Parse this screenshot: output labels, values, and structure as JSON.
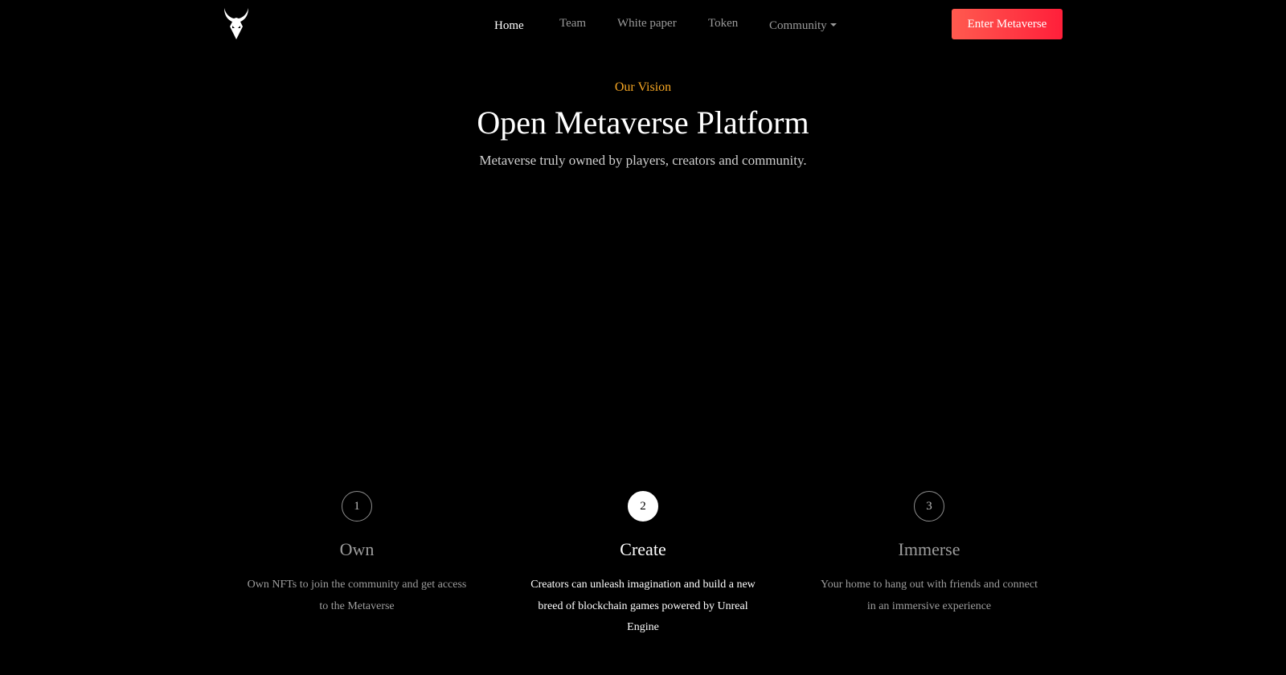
{
  "header": {
    "logo_icon": "horned-bull-skull-icon",
    "nav": [
      {
        "label": "Home",
        "active": true
      },
      {
        "label": "Team"
      },
      {
        "label": "White paper"
      },
      {
        "label": "Token"
      },
      {
        "label": "Community"
      }
    ],
    "cta_label": "Enter Metaverse"
  },
  "hero": {
    "eyebrow": "Our Vision",
    "title": "Open Metaverse Platform",
    "subtitle": "Metaverse truly owned by players, creators and community."
  },
  "steps": [
    {
      "number": "1",
      "title": "Own",
      "description": "Own NFTs to join the community and get access to the Metaverse"
    },
    {
      "number": "2",
      "title": "Create",
      "description": "Creators can unleash imagination and build a new breed of blockchain games powered by Unreal Engine",
      "active": true
    },
    {
      "number": "3",
      "title": "Immerse",
      "description": "Your home to hang out with friends and connect in an immersive experience"
    }
  ],
  "colors": {
    "background": "#000000",
    "accent": "#f5a623",
    "cta_start": "#ff5a4f",
    "cta_end": "#ff1f3a"
  }
}
